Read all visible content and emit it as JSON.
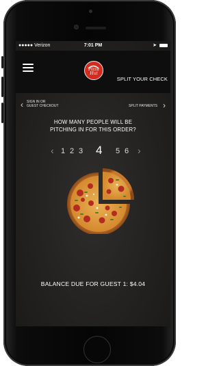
{
  "status_bar": {
    "carrier": "●●●●● Verizon",
    "time": "7:01 PM"
  },
  "header": {
    "brand_logo_text": "Pizza Hut",
    "title": "SPLIT YOUR CHECK"
  },
  "subnav": {
    "back_label_line1": "SIGN IN OR",
    "back_label_line2": "GUEST CHECKOUT",
    "forward_label": "SPLIT PAYMENTS"
  },
  "question": {
    "line1": "HOW MANY PEOPLE WILL BE",
    "line2": "PITCHING IN FOR THIS ORDER?"
  },
  "people_picker": {
    "options": [
      "1",
      "2",
      "3",
      "4",
      "5",
      "6"
    ],
    "selected": "4"
  },
  "balance": "BALANCE DUE FOR GUEST 1: $4.04",
  "colors": {
    "brand_red": "#d32b1e",
    "screen_bg": "#232220",
    "header_bg": "#0e0e0e"
  },
  "icons": [
    "hamburger-menu-icon",
    "chevron-left-icon",
    "chevron-right-icon",
    "wifi-icon",
    "battery-icon",
    "pizza-hut-logo"
  ]
}
